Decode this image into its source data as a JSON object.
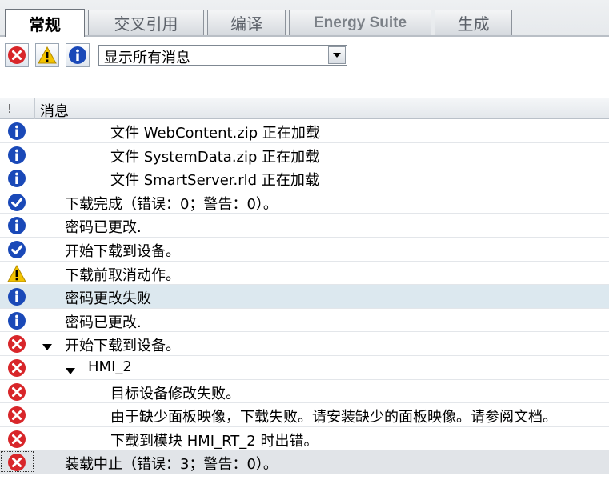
{
  "tabs": [
    {
      "label": "常规",
      "active": true
    },
    {
      "label": "交叉引用",
      "active": false
    },
    {
      "label": "编译",
      "active": false
    },
    {
      "label": "Energy Suite",
      "active": false
    },
    {
      "label": "生成",
      "active": false
    }
  ],
  "toolbar": {
    "filter_buttons": [
      "error-icon",
      "warning-icon",
      "info-icon"
    ],
    "filter_value": "显示所有消息"
  },
  "table": {
    "col_status": "!",
    "col_message": "消息"
  },
  "colors": {
    "error": "#d8262a",
    "warning": "#f3c300",
    "info": "#1a49b8",
    "success": "#1a49b8",
    "selected_row": "#dce8ef"
  },
  "messages": [
    {
      "type": "info",
      "level": 2,
      "text": "文件 WebContent.zip 正在加载"
    },
    {
      "type": "info",
      "level": 2,
      "text": "文件 SystemData.zip 正在加载"
    },
    {
      "type": "info",
      "level": 2,
      "text": "文件 SmartServer.rld 正在加载"
    },
    {
      "type": "success",
      "level": 0,
      "text": "下载完成（错误：0；警告：0）。"
    },
    {
      "type": "info",
      "level": 0,
      "text": "密码已更改."
    },
    {
      "type": "success",
      "level": 0,
      "text": "开始下载到设备。"
    },
    {
      "type": "warning",
      "level": 0,
      "text": "下载前取消动作。"
    },
    {
      "type": "info",
      "level": 0,
      "text": "密码更改失败",
      "selected": true
    },
    {
      "type": "info",
      "level": 0,
      "text": "密码已更改."
    },
    {
      "type": "error",
      "level": 0,
      "text": "开始下载到设备。",
      "expander": "expanded"
    },
    {
      "type": "error",
      "level": 1,
      "text": "HMI_2",
      "expander": "expanded"
    },
    {
      "type": "error",
      "level": 2,
      "text": "目标设备修改失败。"
    },
    {
      "type": "error",
      "level": 2,
      "text": "由于缺少面板映像，下载失败。请安装缺少的面板映像。请参阅文档。"
    },
    {
      "type": "error",
      "level": 2,
      "text": "下载到模块 HMI_RT_2 时出错。"
    },
    {
      "type": "error",
      "level": 0,
      "text": "装载中止（错误：3；警告：0）。",
      "focused": true
    }
  ]
}
